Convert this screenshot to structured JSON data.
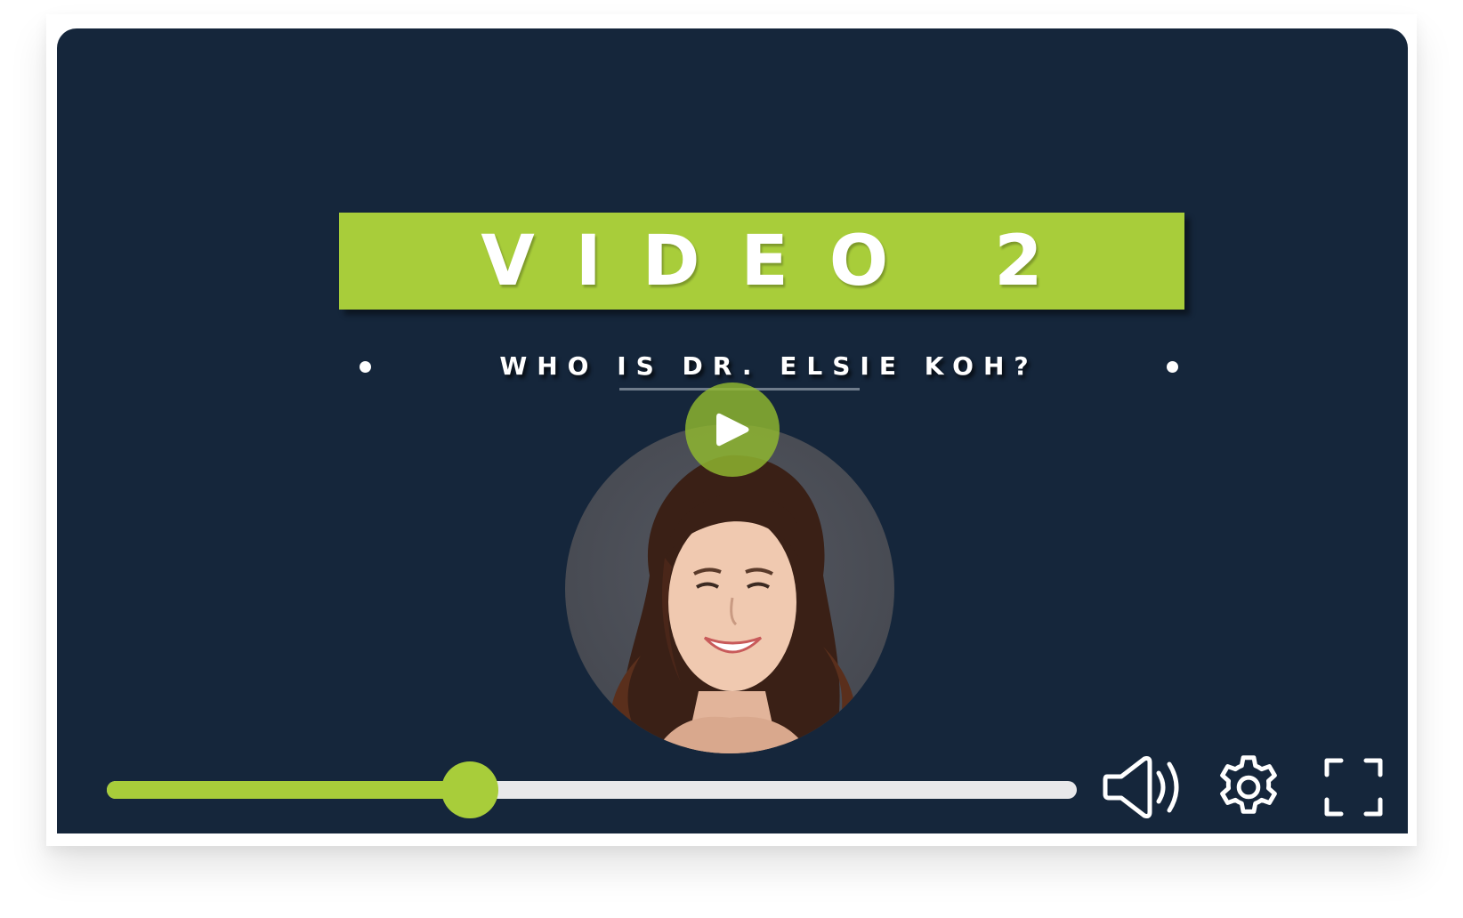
{
  "player": {
    "title": "VIDEO 2",
    "subtitle": "WHO IS DR. ELSIE KOH?",
    "progress_fraction": 0.374,
    "accent_color": "#a8cd3a",
    "background_color": "#15263b",
    "track_color": "#e8e8ea"
  },
  "controls": {
    "play_icon": "play-icon",
    "volume_icon": "volume-icon",
    "settings_icon": "gear-icon",
    "fullscreen_icon": "fullscreen-icon"
  }
}
